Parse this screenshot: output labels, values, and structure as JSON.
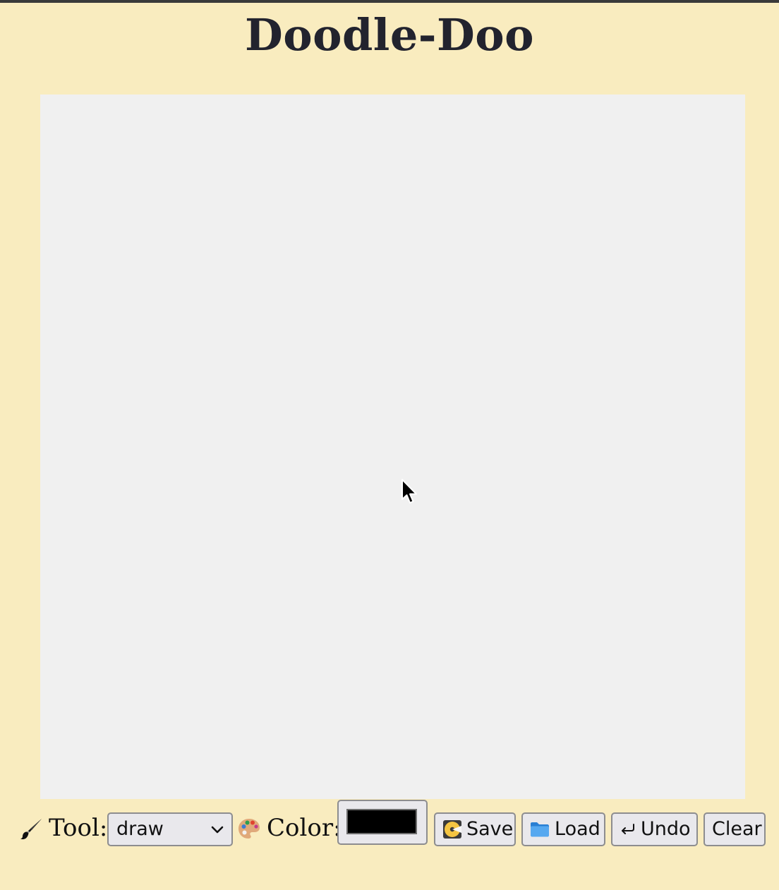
{
  "app": {
    "title": "Doodle-Doo"
  },
  "canvas": {
    "background": "#f0f0f0",
    "cursor_icon": "arrow-pointer"
  },
  "toolbar": {
    "tool_icon": "paintbrush",
    "tool_label": "Tool:",
    "tool_value": "draw",
    "color_icon": "artist-palette",
    "color_label": "Color:",
    "color_value": "#000000",
    "buttons": {
      "save": {
        "icon": "save-disk",
        "label": "Save"
      },
      "load": {
        "icon": "folder",
        "label": "Load"
      },
      "undo": {
        "icon": "return-arrow",
        "label": "Undo"
      },
      "clear": {
        "label": "Clear"
      }
    }
  },
  "colors": {
    "page_background": "#f9ecbf",
    "title_text": "#22232e",
    "control_background": "#e9e8ec",
    "control_border": "#8d8d8f"
  }
}
